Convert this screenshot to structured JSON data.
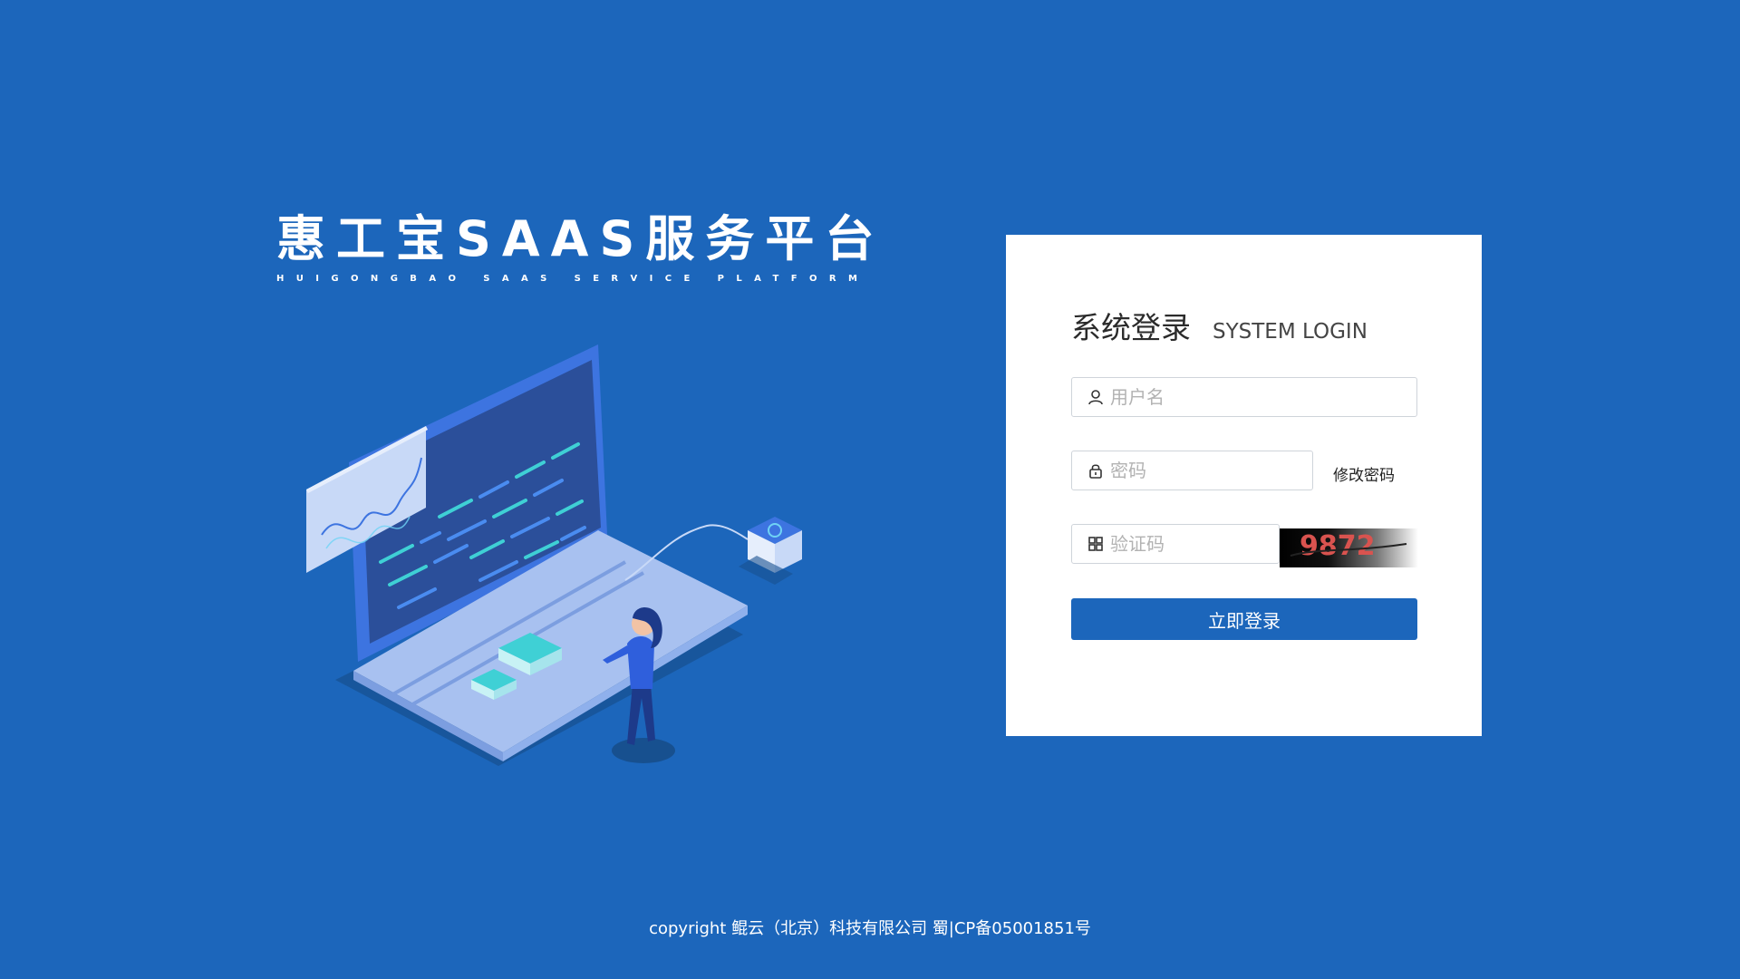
{
  "brand": {
    "title": "惠工宝SAAS服务平台",
    "subtitle": "HUIGONGBAO SAAS SERVICE PLATFORM"
  },
  "login": {
    "title": "系统登录",
    "title_en": "SYSTEM LOGIN",
    "username_placeholder": "用户名",
    "password_placeholder": "密码",
    "change_password_label": "修改密码",
    "captcha_placeholder": "验证码",
    "captcha_text": "9872",
    "submit_label": "立即登录"
  },
  "icons": {
    "username": "user-icon",
    "password": "lock-icon",
    "captcha": "grid-icon"
  },
  "colors": {
    "background": "#1c66bb",
    "primary_button": "#1c66bb",
    "card": "#ffffff",
    "captcha_text": "#d9534f"
  },
  "footer": {
    "copyright": "copyright  鲲云（北京）科技有限公司  蜀|CP备05001851号"
  }
}
